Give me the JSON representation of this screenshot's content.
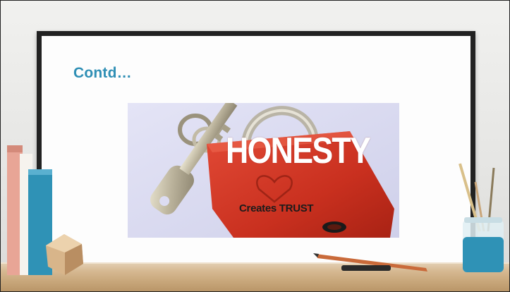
{
  "slide": {
    "title": "Contd…"
  },
  "image": {
    "headline": "HONESTY",
    "caption": "Creates TRUST"
  },
  "colors": {
    "title": "#2f8fb5",
    "board_frame": "#222222",
    "lock_red": "#d23a2a",
    "photo_bg": "#dcdcf2"
  }
}
